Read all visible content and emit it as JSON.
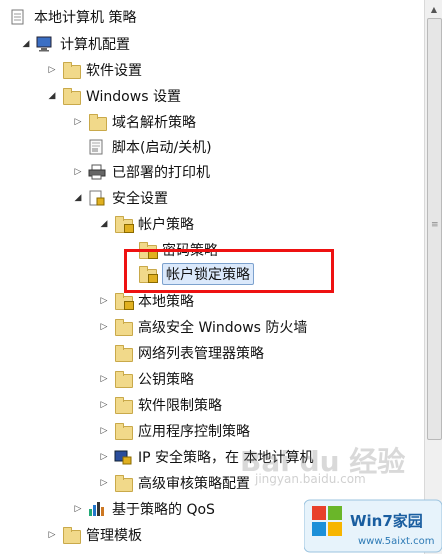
{
  "tree": [
    {
      "key": "root",
      "label": "本地计算机 策略",
      "icon": "policy-doc-icon",
      "arrow": ""
    },
    {
      "key": "computer_config",
      "label": "计算机配置",
      "icon": "computer-icon",
      "arrow": "open"
    },
    {
      "key": "software_settings",
      "label": "软件设置",
      "icon": "folder-icon",
      "arrow": "closed"
    },
    {
      "key": "windows_settings",
      "label": "Windows 设置",
      "icon": "folder-icon",
      "arrow": "open"
    },
    {
      "key": "name_resolution",
      "label": "域名解析策略",
      "icon": "folder-icon",
      "arrow": "closed"
    },
    {
      "key": "scripts",
      "label": "脚本(启动/关机)",
      "icon": "script-icon",
      "arrow": ""
    },
    {
      "key": "printers",
      "label": "已部署的打印机",
      "icon": "printer-icon",
      "arrow": "closed"
    },
    {
      "key": "security_settings",
      "label": "安全设置",
      "icon": "security-doc-icon",
      "arrow": "open"
    },
    {
      "key": "account_policies",
      "label": "帐户策略",
      "icon": "locked-folder-icon",
      "arrow": "open"
    },
    {
      "key": "password_policy",
      "label": "密码策略",
      "icon": "locked-folder-icon",
      "arrow": ""
    },
    {
      "key": "account_lockout",
      "label": "帐户锁定策略",
      "icon": "locked-folder-icon",
      "arrow": "",
      "selected": true
    },
    {
      "key": "local_policies",
      "label": "本地策略",
      "icon": "locked-folder-icon",
      "arrow": "closed"
    },
    {
      "key": "firewall",
      "label": "高级安全 Windows 防火墙",
      "icon": "folder-icon",
      "arrow": "closed"
    },
    {
      "key": "network_list",
      "label": "网络列表管理器策略",
      "icon": "folder-icon",
      "arrow": ""
    },
    {
      "key": "public_key",
      "label": "公钥策略",
      "icon": "folder-icon",
      "arrow": "closed"
    },
    {
      "key": "software_restriction",
      "label": "软件限制策略",
      "icon": "folder-icon",
      "arrow": "closed"
    },
    {
      "key": "app_control",
      "label": "应用程序控制策略",
      "icon": "folder-icon",
      "arrow": "closed"
    },
    {
      "key": "ip_security",
      "label": "IP 安全策略，在 本地计算机",
      "icon": "ip-security-icon",
      "arrow": "closed"
    },
    {
      "key": "audit",
      "label": "高级审核策略配置",
      "icon": "folder-icon",
      "arrow": "closed"
    },
    {
      "key": "qos",
      "label": "基于策略的 QoS",
      "icon": "chart-icon",
      "arrow": "closed"
    },
    {
      "key": "admin_templates",
      "label": "管理模板",
      "icon": "folder-icon",
      "arrow": "closed"
    }
  ],
  "colors": {
    "highlight_box": "#ee1111",
    "selection": "#dbe9fb",
    "folder": "#f1d98a"
  }
}
